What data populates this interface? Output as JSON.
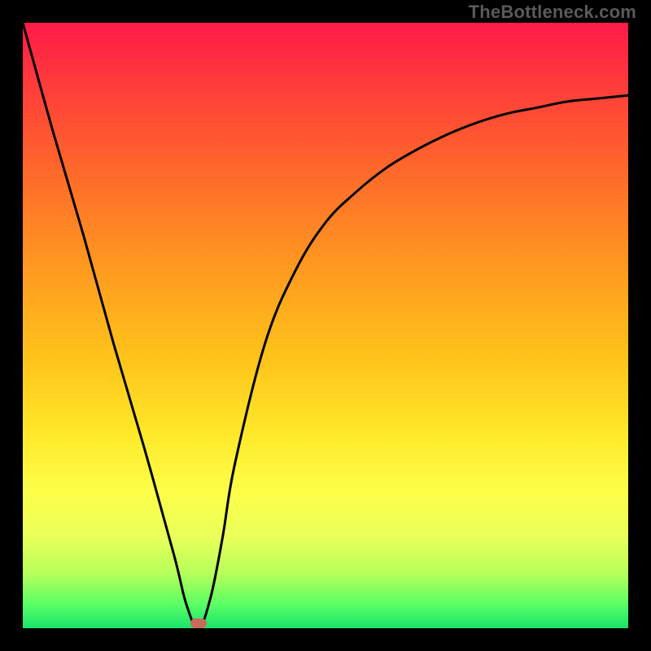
{
  "watermark": "TheBottleneck.com",
  "chart_data": {
    "type": "line",
    "title": "",
    "xlabel": "",
    "ylabel": "",
    "xlim": [
      0,
      100
    ],
    "ylim": [
      0,
      100
    ],
    "grid": false,
    "series": [
      {
        "name": "bottleneck-curve",
        "x": [
          0,
          5,
          10,
          15,
          20,
          25,
          27,
          29,
          31,
          33,
          35,
          40,
          45,
          50,
          55,
          60,
          65,
          70,
          75,
          80,
          85,
          90,
          95,
          100
        ],
        "y": [
          100,
          82,
          65,
          47,
          30,
          12,
          4,
          0,
          5,
          15,
          27,
          47,
          59,
          67,
          72,
          76,
          79,
          81.5,
          83.5,
          85,
          86,
          87,
          87.5,
          88
        ]
      }
    ],
    "marker": {
      "name": "optimal-point",
      "x": 29,
      "y": 0.8,
      "color": "#c96b5a"
    },
    "gradient_colors": {
      "top": "#ff1a49",
      "bottom": "#19e36b"
    }
  }
}
